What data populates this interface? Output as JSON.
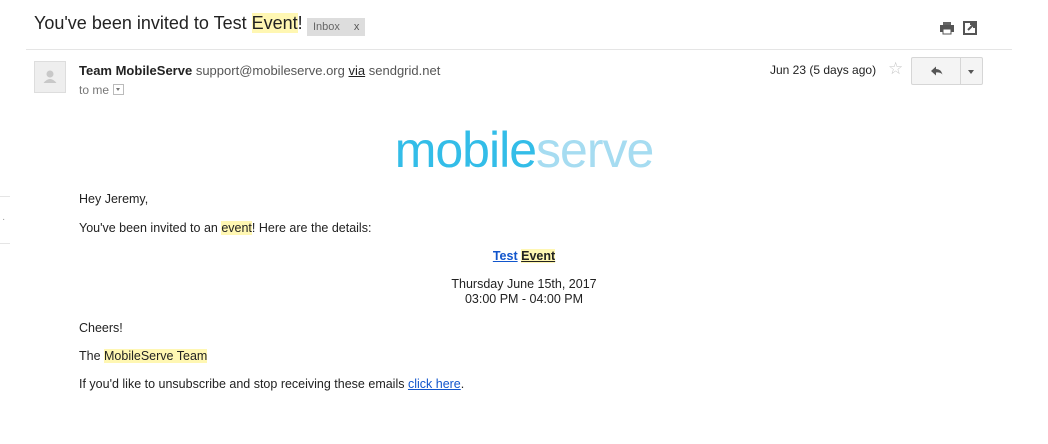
{
  "email": {
    "subject_pre": "You've been invited to Test ",
    "subject_hl": "Event",
    "subject_post": "!",
    "label": "Inbox",
    "label_close": "x",
    "sender_name": "Team MobileServe",
    "sender_email": "support@mobileserve.org",
    "via_label": "via",
    "via_domain": "sendgrid.net",
    "recipient": "to me",
    "date": "Jun 23 (5 days ago)"
  },
  "logo": {
    "part1": "mobile",
    "part2": "serve"
  },
  "body": {
    "greeting": "Hey Jeremy,",
    "invite_pre": "You've been invited to an ",
    "invite_hl": "event",
    "invite_post": "! Here are the details:",
    "event_name_1": "Test",
    "event_name_2": "Event",
    "event_date": "Thursday June 15th, 2017",
    "event_time": "03:00 PM - 04:00 PM",
    "closing": "Cheers!",
    "signoff_pre": "The ",
    "signoff_hl": "MobileServe Team",
    "unsubscribe_pre": "If you'd like to unsubscribe and stop receiving these emails ",
    "unsubscribe_link": "click here",
    "unsubscribe_post": "."
  },
  "icons": [
    "print-icon",
    "new-window-icon",
    "star-icon",
    "reply-icon",
    "more-options-icon",
    "avatar-icon",
    "chevron-down-icon"
  ],
  "colors": {
    "logo_primary": "#33bde8",
    "logo_secondary": "#a6dcf1",
    "highlight": "#fff7b3",
    "link": "#1155cc"
  }
}
